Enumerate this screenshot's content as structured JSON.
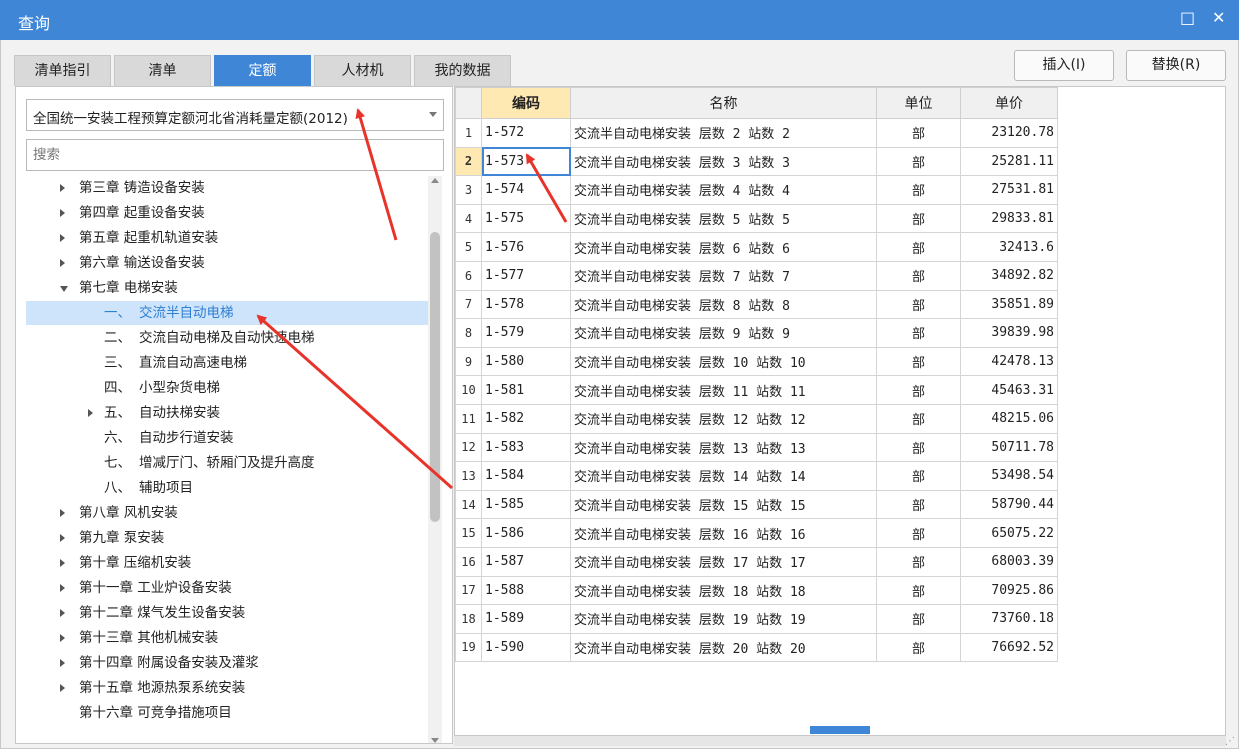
{
  "window": {
    "title": "查询",
    "restore_icon": "□",
    "close_icon": "✕"
  },
  "tabs": [
    {
      "label": "清单指引",
      "active": false
    },
    {
      "label": "清单",
      "active": false
    },
    {
      "label": "定额",
      "active": true
    },
    {
      "label": "人材机",
      "active": false
    },
    {
      "label": "我的数据",
      "active": false
    }
  ],
  "buttons": {
    "insert": "插入(I)",
    "replace": "替换(R)"
  },
  "quota_library": {
    "selected": "全国统一安装工程预算定额河北省消耗量定额(2012)"
  },
  "search": {
    "placeholder": "搜索",
    "value": ""
  },
  "tree": [
    {
      "label": "第三章 铸造设备安装",
      "state": "collapsed"
    },
    {
      "label": "第四章 起重设备安装",
      "state": "collapsed"
    },
    {
      "label": "第五章 起重机轨道安装",
      "state": "collapsed"
    },
    {
      "label": "第六章 输送设备安装",
      "state": "collapsed"
    },
    {
      "label": "第七章 电梯安装",
      "state": "expanded"
    },
    {
      "num": "一、",
      "label": "交流半自动电梯",
      "selected": true
    },
    {
      "num": "二、",
      "label": "交流自动电梯及自动快速电梯"
    },
    {
      "num": "三、",
      "label": "直流自动高速电梯"
    },
    {
      "num": "四、",
      "label": "小型杂货电梯"
    },
    {
      "num": "五、",
      "label": "自动扶梯安装",
      "state": "collapsed"
    },
    {
      "num": "六、",
      "label": "自动步行道安装"
    },
    {
      "num": "七、",
      "label": "增减厅门、轿厢门及提升高度"
    },
    {
      "num": "八、",
      "label": "辅助项目"
    },
    {
      "label": "第八章 风机安装",
      "state": "collapsed"
    },
    {
      "label": "第九章 泵安装",
      "state": "collapsed"
    },
    {
      "label": "第十章 压缩机安装",
      "state": "collapsed"
    },
    {
      "label": "第十一章 工业炉设备安装",
      "state": "collapsed"
    },
    {
      "label": "第十二章 煤气发生设备安装",
      "state": "collapsed"
    },
    {
      "label": "第十三章 其他机械安装",
      "state": "collapsed"
    },
    {
      "label": "第十四章 附属设备安装及灌浆",
      "state": "collapsed"
    },
    {
      "label": "第十五章 地源热泵系统安装",
      "state": "collapsed"
    },
    {
      "label": "第十六章 可竞争措施项目"
    }
  ],
  "table": {
    "columns": [
      "编码",
      "名称",
      "单位",
      "单价"
    ],
    "current_row": 2,
    "rows": [
      {
        "no": "1",
        "code": "1-572",
        "name": "交流半自动电梯安装 层数 2 站数 2",
        "unit": "部",
        "price": "23120.78"
      },
      {
        "no": "2",
        "code": "1-573",
        "name": "交流半自动电梯安装 层数 3 站数 3",
        "unit": "部",
        "price": "25281.11"
      },
      {
        "no": "3",
        "code": "1-574",
        "name": "交流半自动电梯安装 层数 4 站数 4",
        "unit": "部",
        "price": "27531.81"
      },
      {
        "no": "4",
        "code": "1-575",
        "name": "交流半自动电梯安装 层数 5 站数 5",
        "unit": "部",
        "price": "29833.81"
      },
      {
        "no": "5",
        "code": "1-576",
        "name": "交流半自动电梯安装 层数 6 站数 6",
        "unit": "部",
        "price": "32413.6"
      },
      {
        "no": "6",
        "code": "1-577",
        "name": "交流半自动电梯安装 层数 7 站数 7",
        "unit": "部",
        "price": "34892.82"
      },
      {
        "no": "7",
        "code": "1-578",
        "name": "交流半自动电梯安装 层数 8 站数 8",
        "unit": "部",
        "price": "35851.89"
      },
      {
        "no": "8",
        "code": "1-579",
        "name": "交流半自动电梯安装 层数 9 站数 9",
        "unit": "部",
        "price": "39839.98"
      },
      {
        "no": "9",
        "code": "1-580",
        "name": "交流半自动电梯安装 层数 10 站数 10",
        "unit": "部",
        "price": "42478.13"
      },
      {
        "no": "10",
        "code": "1-581",
        "name": "交流半自动电梯安装 层数 11 站数 11",
        "unit": "部",
        "price": "45463.31"
      },
      {
        "no": "11",
        "code": "1-582",
        "name": "交流半自动电梯安装 层数 12 站数 12",
        "unit": "部",
        "price": "48215.06"
      },
      {
        "no": "12",
        "code": "1-583",
        "name": "交流半自动电梯安装 层数 13 站数 13",
        "unit": "部",
        "price": "50711.78"
      },
      {
        "no": "13",
        "code": "1-584",
        "name": "交流半自动电梯安装 层数 14 站数 14",
        "unit": "部",
        "price": "53498.54"
      },
      {
        "no": "14",
        "code": "1-585",
        "name": "交流半自动电梯安装 层数 15 站数 15",
        "unit": "部",
        "price": "58790.44"
      },
      {
        "no": "15",
        "code": "1-586",
        "name": "交流半自动电梯安装 层数 16 站数 16",
        "unit": "部",
        "price": "65075.22"
      },
      {
        "no": "16",
        "code": "1-587",
        "name": "交流半自动电梯安装 层数 17 站数 17",
        "unit": "部",
        "price": "68003.39"
      },
      {
        "no": "17",
        "code": "1-588",
        "name": "交流半自动电梯安装 层数 18 站数 18",
        "unit": "部",
        "price": "70925.86"
      },
      {
        "no": "18",
        "code": "1-589",
        "name": "交流半自动电梯安装 层数 19 站数 19",
        "unit": "部",
        "price": "73760.18"
      },
      {
        "no": "19",
        "code": "1-590",
        "name": "交流半自动电梯安装 层数 20 站数 20",
        "unit": "部",
        "price": "76692.52"
      }
    ]
  },
  "colors": {
    "accent": "#3f87d6",
    "tree_selected_bg": "#cde4fb",
    "header_highlight": "#ffe9b3",
    "annotation_arrow": "#e8332a"
  }
}
